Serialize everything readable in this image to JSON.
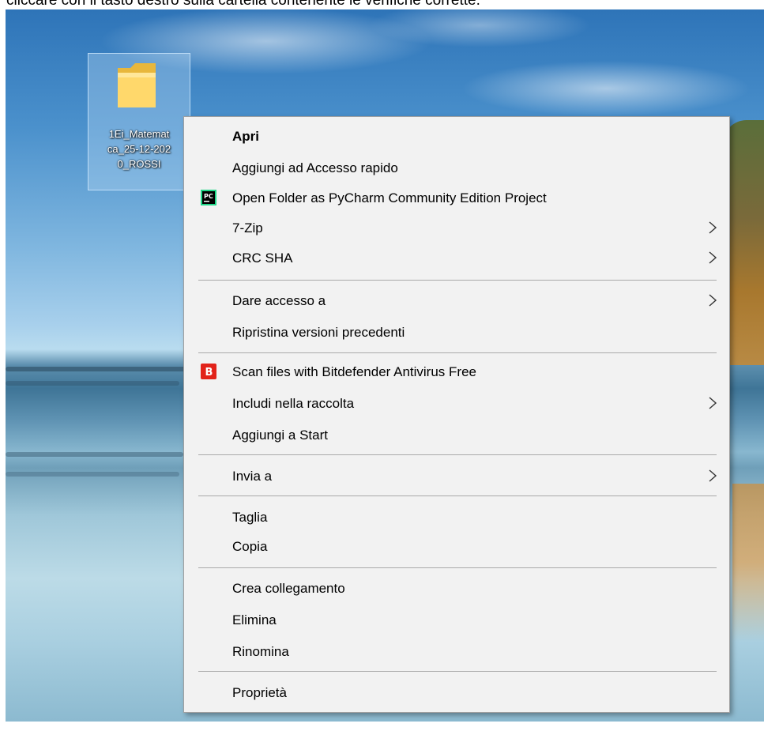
{
  "caption": "cliccare con il tasto destro sulla cartella contenente le verifiche corrette.",
  "desktop": {
    "folder": {
      "icon": "folder-icon",
      "label": "1Ei_Matemat\nca_25-12-202\n0_ROSSI"
    }
  },
  "context_menu": {
    "open": "Apri",
    "pin_quick_access": "Aggiungi ad Accesso rapido",
    "pycharm": {
      "label": "Open Folder as PyCharm Community Edition Project",
      "icon": "pycharm-icon",
      "icon_text": "PC"
    },
    "seven_zip": "7-Zip",
    "crc_sha": "CRC SHA",
    "give_access": "Dare accesso a",
    "restore_versions": "Ripristina versioni precedenti",
    "bitdefender": {
      "label": "Scan files with Bitdefender Antivirus Free",
      "icon": "bitdefender-icon",
      "icon_text": "B"
    },
    "include_library": "Includi nella raccolta",
    "pin_start": "Aggiungi a Start",
    "send_to": "Invia a",
    "cut": "Taglia",
    "copy": "Copia",
    "create_shortcut": "Crea collegamento",
    "delete": "Elimina",
    "rename": "Rinomina",
    "properties": "Proprietà"
  },
  "colors": {
    "menu_background": "#f2f2f2",
    "separator": "#a9a9a9",
    "bitdefender_red": "#e2231a",
    "pycharm_green": "#21d789"
  }
}
